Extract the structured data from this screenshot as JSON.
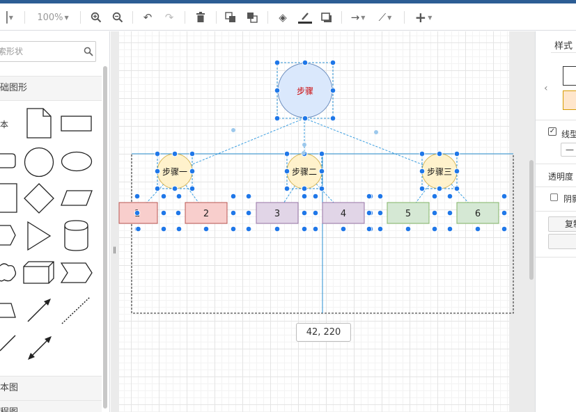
{
  "toolbar": {
    "zoom": "100%",
    "icons": [
      "page-icon",
      "zoom-in-icon",
      "zoom-out-icon",
      "undo-icon",
      "redo-icon",
      "delete-icon",
      "to-front-icon",
      "to-back-icon",
      "fill-color-icon",
      "line-color-icon",
      "shadow-icon",
      "connection-icon",
      "waypoints-icon",
      "insert-icon"
    ]
  },
  "sidebar": {
    "search_placeholder": "索形状",
    "section_general": "础图形",
    "text_shape_label": "本",
    "section_advanced": "本图",
    "section_flowchart": "程图"
  },
  "diagram": {
    "root_label": "步骤",
    "root_color": "#cc0000",
    "steps": [
      "步骤一",
      "步骤二",
      "步骤三"
    ],
    "boxes": [
      "1",
      "2",
      "3",
      "4",
      "5",
      "6"
    ],
    "colors": {
      "root_fill": "#dae8fc",
      "root_stroke": "#6c8ebf",
      "step_fill": "#fff2cc",
      "step_stroke": "#d6b656",
      "red_fill": "#f8cecc",
      "red_stroke": "#b85450",
      "purple_fill": "#e1d5e7",
      "purple_stroke": "#9673a6",
      "green_fill": "#d5e8d4",
      "green_stroke": "#82b366",
      "handle": "#1f77e8",
      "guide": "#2a8fd0"
    }
  },
  "coord_tooltip": "42, 220",
  "format_panel": {
    "title": "样式",
    "line_label": "线型",
    "opacity_label": "透明度",
    "shadow_label": "阴影",
    "copy_button": "复制"
  }
}
